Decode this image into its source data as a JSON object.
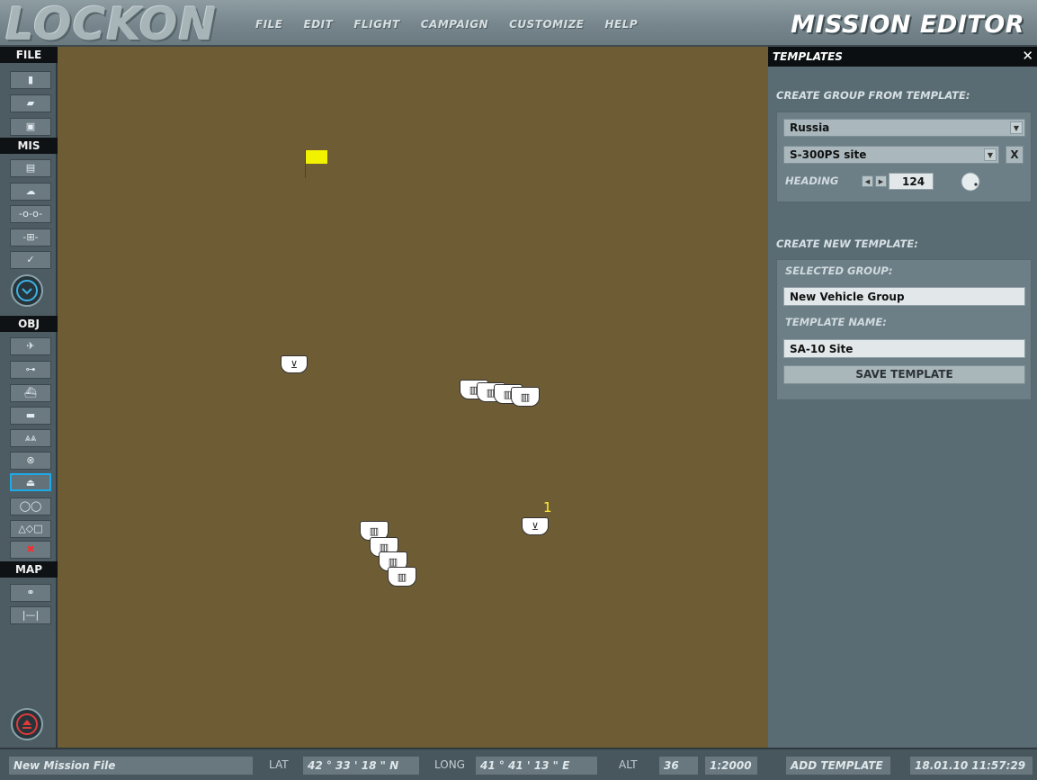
{
  "app": {
    "logo": "LOCKON",
    "title": "MISSION EDITOR",
    "menu": [
      "FILE",
      "EDIT",
      "FLIGHT",
      "CAMPAIGN",
      "CUSTOMIZE",
      "HELP"
    ]
  },
  "toolbar": {
    "sections": {
      "file": "FILE",
      "mis": "MIS",
      "obj": "OBJ",
      "map": "MAP"
    },
    "icons": {
      "file": [
        "new-file-icon",
        "open-folder-icon",
        "save-icon"
      ],
      "mis": [
        "briefing-icon",
        "weather-icon",
        "route-icon",
        "trigger-icon",
        "check-icon"
      ],
      "obj": [
        "plane-icon",
        "helicopter-icon",
        "ship-icon",
        "tank-icon",
        "vehicle-group-icon",
        "static-object-icon",
        "template-icon",
        "zone-icon",
        "shapes-icon",
        "delete-icon"
      ],
      "map": [
        "binoculars-icon",
        "ruler-icon"
      ]
    }
  },
  "map": {
    "background_color": "#6e5c34",
    "flag_color": "#f2f200",
    "unit_label": "1"
  },
  "templates_panel": {
    "title": "TEMPLATES",
    "close": "✕",
    "create_from_label": "CREATE GROUP FROM TEMPLATE:",
    "country": "Russia",
    "template": "S-300PS site",
    "clear": "X",
    "heading_label": "HEADING",
    "heading_value": "124",
    "create_new_label": "CREATE NEW TEMPLATE:",
    "selected_group_label": "SELECTED GROUP:",
    "selected_group": "New Vehicle Group",
    "template_name_label": "TEMPLATE NAME:",
    "template_name": "SA-10 Site",
    "save_button": "SAVE TEMPLATE"
  },
  "status": {
    "mission_file": "New Mission File",
    "lat_label": "LAT",
    "lat": "42 ° 33 ' 18 \" N",
    "long_label": "LONG",
    "long": "41 ° 41 ' 13 \" E",
    "alt_label": "ALT",
    "alt": "36",
    "scale": "1:2000",
    "mode": "ADD TEMPLATE",
    "datetime": "18.01.10 11:57:29"
  }
}
